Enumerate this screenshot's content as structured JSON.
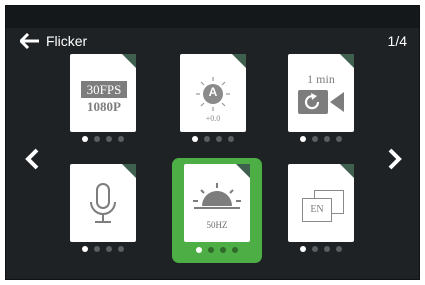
{
  "header": {
    "title": "Flicker",
    "page_indicator": "1/4",
    "back_icon": "arrow-left-icon"
  },
  "nav": {
    "prev_icon": "chevron-left-icon",
    "next_icon": "chevron-right-icon"
  },
  "tiles": [
    {
      "name": "resolution",
      "line1": "30FPS",
      "line2": "1080P",
      "icon": "video-resolution-icon",
      "active_dot": 0,
      "dot_count": 4
    },
    {
      "name": "exposure",
      "letter": "A",
      "value": "+0.0",
      "icon": "exposure-sun-icon",
      "active_dot": 0,
      "dot_count": 4
    },
    {
      "name": "loop-recording",
      "value": "1 min",
      "icon": "loop-video-icon",
      "active_dot": 0,
      "dot_count": 4
    },
    {
      "name": "microphone",
      "icon": "microphone-icon",
      "active_dot": 0,
      "dot_count": 4
    },
    {
      "name": "flicker",
      "value": "50HZ",
      "icon": "sunrise-icon",
      "active_dot": 0,
      "dot_count": 4,
      "selected": true
    },
    {
      "name": "language",
      "value": "EN",
      "icon": "language-icon",
      "active_dot": 0,
      "dot_count": 4
    }
  ],
  "colors": {
    "background": "#1e2225",
    "selection": "#4dae45",
    "corner_tab": "#3f5f4f",
    "icon_gray": "#7a7a7a"
  }
}
